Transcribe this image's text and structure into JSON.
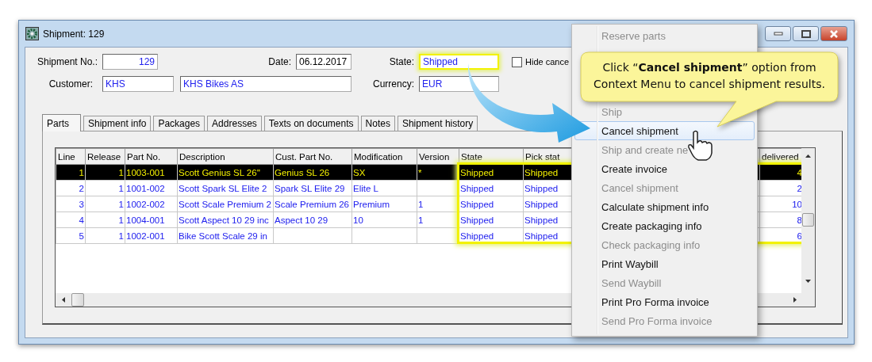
{
  "window": {
    "title": "Shipment: 129"
  },
  "form": {
    "shipment_no": {
      "label": "Shipment No.:",
      "value": "129"
    },
    "date": {
      "label": "Date:",
      "value": "06.12.2017"
    },
    "state": {
      "label": "State:",
      "value": "Shipped"
    },
    "hide_cancelled": {
      "label": "Hide cance",
      "checked": false
    },
    "customer": {
      "label": "Customer:",
      "code": "KHS",
      "name": "KHS Bikes AS"
    },
    "currency": {
      "label": "Currency:",
      "value": "EUR"
    }
  },
  "tabs": [
    {
      "label": "Parts",
      "selected": true
    },
    {
      "label": "Shipment info",
      "selected": false
    },
    {
      "label": "Packages",
      "selected": false
    },
    {
      "label": "Addresses",
      "selected": false
    },
    {
      "label": "Texts on documents",
      "selected": false
    },
    {
      "label": "Notes",
      "selected": false
    },
    {
      "label": "Shipment history",
      "selected": false
    }
  ],
  "table": {
    "columns": [
      "Line",
      "Release",
      "Part No.",
      "Description",
      "Cust. Part No.",
      "Modification",
      "Version",
      "State",
      "Pick stat",
      "delivered"
    ],
    "rows": [
      {
        "selected": true,
        "cells": [
          "1",
          "1",
          "1003-001",
          "Scott Genius SL 26''",
          "Genius SL 26",
          "SX",
          "*",
          "Shipped",
          "Shipped",
          "4"
        ]
      },
      {
        "selected": false,
        "cells": [
          "2",
          "1",
          "1001-002",
          "Scott Spark SL Elite 2",
          "Spark SL Elite 29",
          "Elite L",
          "",
          "Shipped",
          "Shipped",
          "2"
        ]
      },
      {
        "selected": false,
        "cells": [
          "3",
          "1",
          "1002-002",
          "Scott Scale Premium 2",
          "Scale Premium 26",
          "Premium",
          "1",
          "Shipped",
          "Shipped",
          "10"
        ]
      },
      {
        "selected": false,
        "cells": [
          "4",
          "1",
          "1004-001",
          "Scott Aspect 10 29 inc",
          "Aspect 10 29",
          "10",
          "1",
          "Shipped",
          "Shipped",
          "8"
        ]
      },
      {
        "selected": false,
        "cells": [
          "5",
          "1",
          "1002-001",
          "Bike Scott Scale 29 in",
          "",
          "",
          "",
          "Shipped",
          "Shipped",
          "6"
        ]
      }
    ]
  },
  "menu": {
    "top_items": [
      {
        "label": "Reserve parts",
        "disabled": true,
        "selected": false
      }
    ],
    "items": [
      {
        "label": "Ship",
        "disabled": true,
        "selected": false
      },
      {
        "label": "Cancel shipment",
        "disabled": false,
        "selected": true
      },
      {
        "label": "Ship and create ne",
        "disabled": true,
        "selected": false
      },
      {
        "label": "Create invoice",
        "disabled": false,
        "selected": false
      },
      {
        "label": "Cancel shipment",
        "disabled": true,
        "selected": false
      },
      {
        "label": "Calculate shipment info",
        "disabled": false,
        "selected": false
      },
      {
        "label": "Create packaging info",
        "disabled": false,
        "selected": false
      },
      {
        "label": "Check packaging info",
        "disabled": true,
        "selected": false
      },
      {
        "label": "Print Waybill",
        "disabled": false,
        "selected": false
      },
      {
        "label": "Send Waybill",
        "disabled": true,
        "selected": false
      },
      {
        "label": "Print Pro Forma invoice",
        "disabled": false,
        "selected": false
      },
      {
        "label": "Send Pro Forma invoice",
        "disabled": true,
        "selected": false
      }
    ]
  },
  "callout": {
    "text": "Click “**Cancel shipment**” option from Context Menu to cancel shipment results."
  }
}
